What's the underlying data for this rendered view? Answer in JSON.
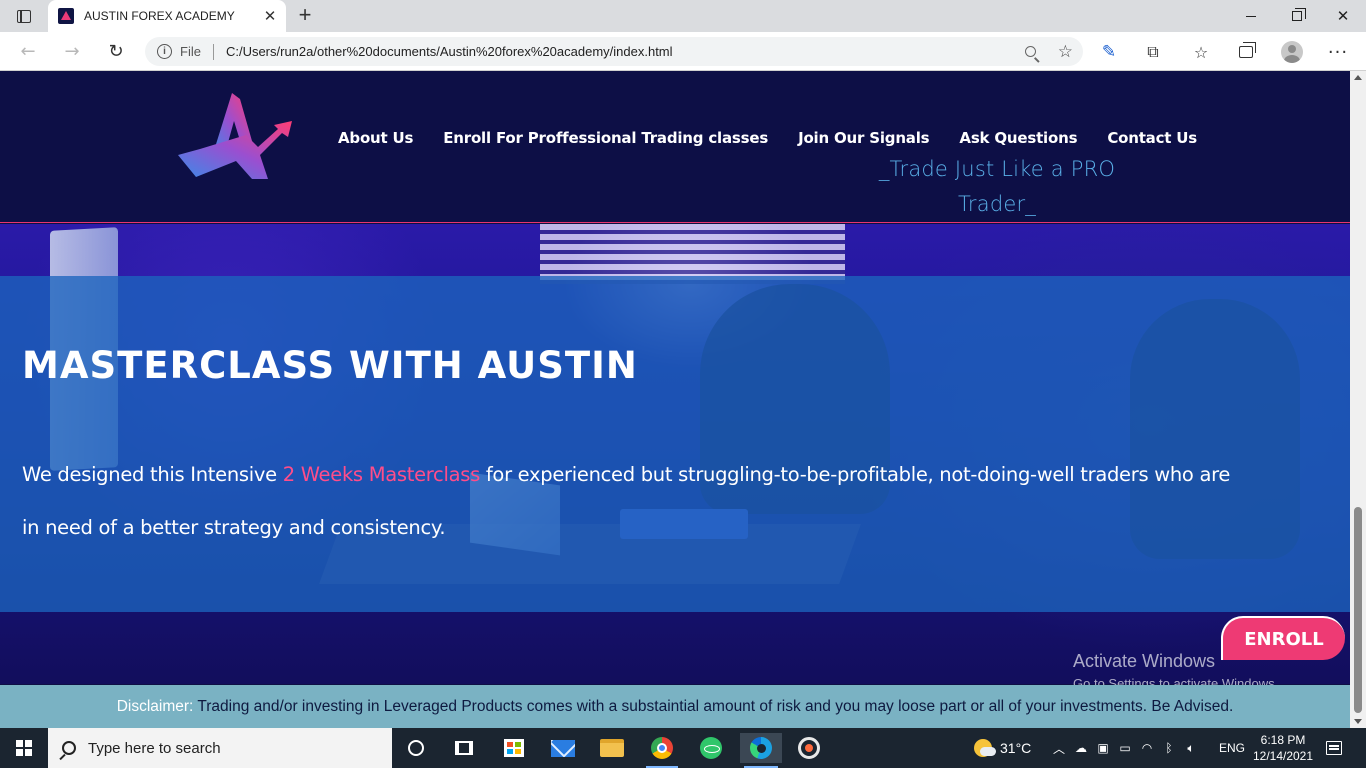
{
  "browser": {
    "tab_title": "AUSTIN FOREX ACADEMY",
    "tab_close": "✕",
    "new_tab": "+",
    "address": {
      "file_label": "File",
      "url": "C:/Users/run2a/other%20documents/Austin%20forex%20academy/index.html"
    },
    "icons": [
      "tab-actions-icon",
      "back-icon",
      "forward-icon",
      "reload-icon",
      "info-icon",
      "zoom-icon",
      "favorites-add-icon",
      "extension-pen-icon",
      "extensions-icon",
      "favorites-icon",
      "collections-icon",
      "profile-icon",
      "more-icon"
    ]
  },
  "site": {
    "nav": [
      {
        "label": "About Us"
      },
      {
        "label": "Enroll For Proffessional Trading classes"
      },
      {
        "label": "Join Our Signals"
      },
      {
        "label": "Ask Questions"
      },
      {
        "label": "Contact Us"
      }
    ],
    "tagline_line1": "_Trade Just Like a PRO",
    "tagline_line2": "Trader_",
    "hero": {
      "title": "MASTERCLASS WITH AUSTIN",
      "text_before": "We designed this Intensive ",
      "text_highlight": "2 Weeks Masterclass",
      "text_after": " for experienced but struggling-to-be-profitable, not-doing-well traders who are in need of a better strategy and consistency."
    },
    "enroll_label": "ENROLL",
    "disclaimer_label": "Disclaimer:",
    "disclaimer_text": "Trading and/or investing in Leveraged Products comes with a substaintial amount of risk and you may loose part or all of your investments. Be Advised.",
    "colors": {
      "header_bg": "#0d0f46",
      "accent_pink": "#ee3a74",
      "tagline_blue": "#5ab0e8",
      "overlay_blue": "#1c64be",
      "disclaimer_bg": "#7ab2c3"
    }
  },
  "watermark": {
    "title": "Activate Windows",
    "subtitle": "Go to Settings to activate Windows."
  },
  "taskbar": {
    "search_placeholder": "Type here to search",
    "weather_temp": "31°C",
    "language": "ENG",
    "time": "6:18 PM",
    "date": "12/14/2021"
  }
}
